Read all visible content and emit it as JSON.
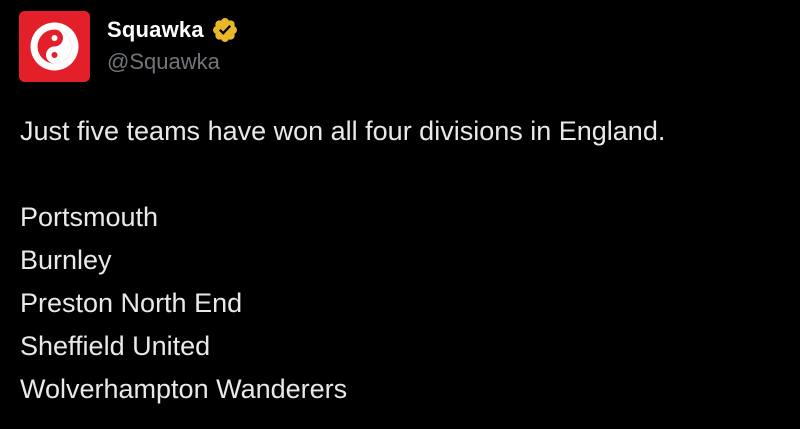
{
  "author": {
    "display_name": "Squawka",
    "handle": "@Squawka",
    "avatar_icon": "squawka-logo",
    "verified_icon": "gold-verified-badge-icon",
    "brand_color": "#e3202a",
    "badge_color": "#e8b829"
  },
  "tweet": {
    "intro": "Just five teams have won all four divisions in England.",
    "teams": [
      "Portsmouth",
      "Burnley",
      "Preston North End",
      "Sheffield United",
      "Wolverhampton Wanderers"
    ]
  }
}
